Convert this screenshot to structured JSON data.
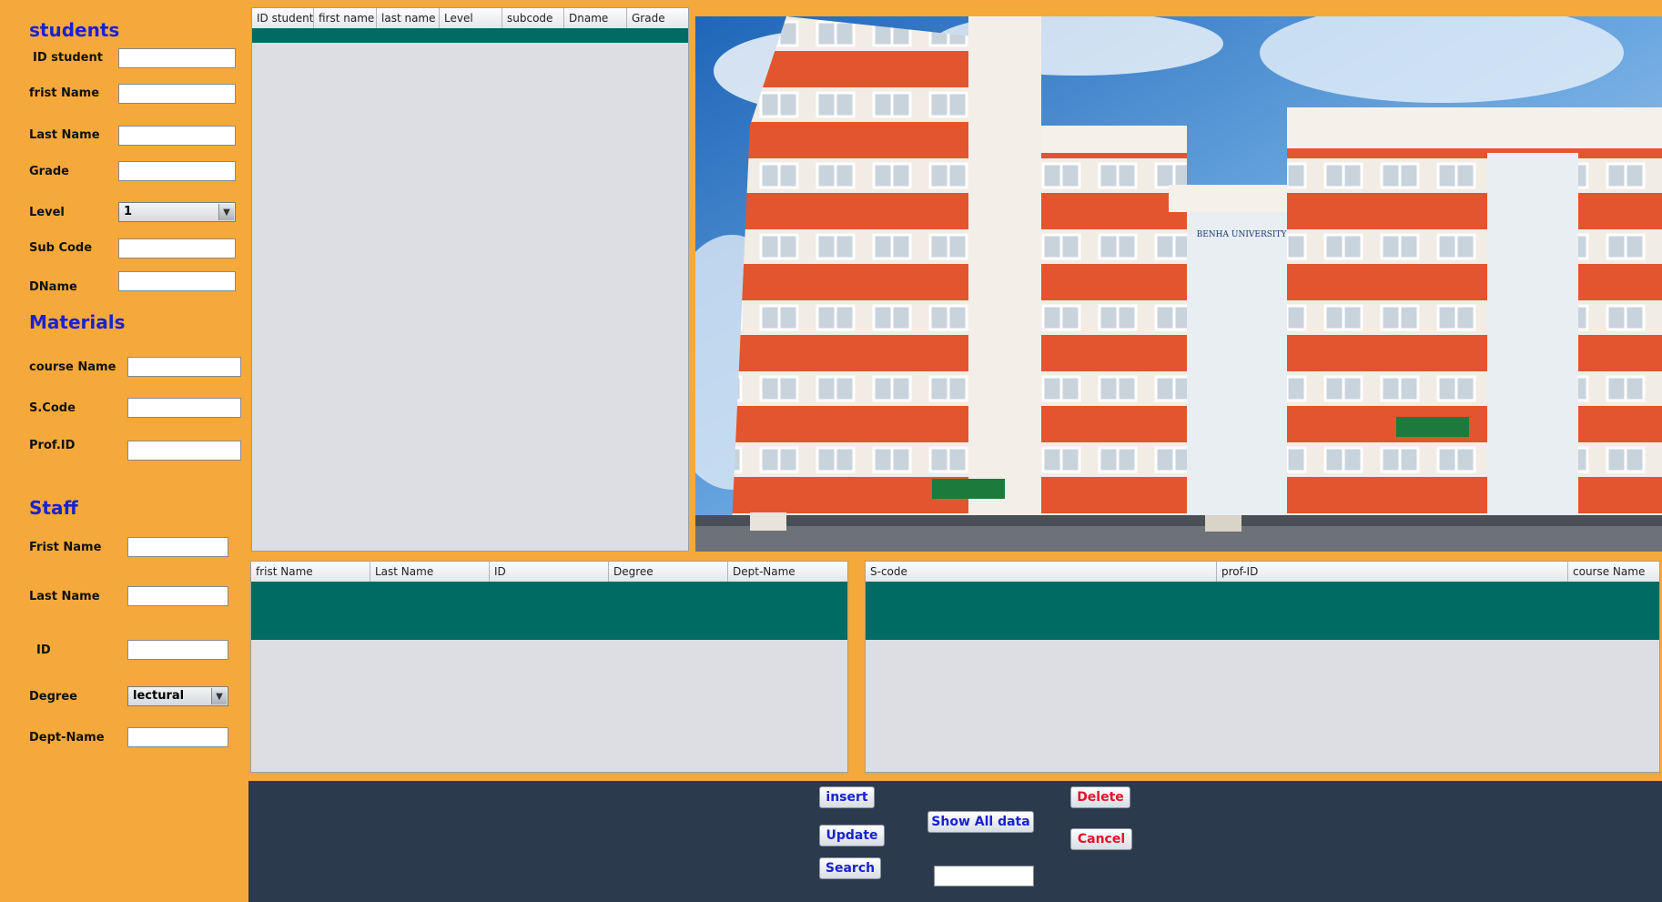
{
  "students": {
    "title": "students",
    "labels": [
      "ID student",
      "frist Name",
      "Last Name",
      "Grade",
      "Level",
      "Sub Code",
      "DName"
    ],
    "level_value": "1"
  },
  "materials": {
    "title": "Materials",
    "labels": [
      "course Name",
      "S.Code",
      "Prof.ID"
    ]
  },
  "staff": {
    "title": "Staff",
    "labels": [
      "Frist Name",
      "Last Name",
      "ID",
      "Degree",
      "Dept-Name"
    ],
    "degree_value": "lectural"
  },
  "tables": {
    "students_columns": [
      "ID student",
      "first name",
      "last name",
      "Level",
      "subcode",
      "Dname",
      "Grade"
    ],
    "staff_columns": [
      "frist Name",
      "Last Name",
      "ID",
      "Degree",
      "Dept-Name"
    ],
    "materials_columns": [
      "S-code",
      "prof-ID",
      "course Name"
    ]
  },
  "buttons": {
    "insert": "insert",
    "update": "Update",
    "search": "Search",
    "show_all": "Show All data",
    "delete": "Delete",
    "cancel": "Cancel"
  },
  "search_input_value": "",
  "photo": {
    "sign_text": "BENHA UNIVERSITY"
  },
  "colors": {
    "background": "#f5a93a",
    "section_title": "#1a22d0",
    "table_selection": "#006b63",
    "bottom_bar": "#2c3a4e",
    "danger_text": "#e0142c"
  }
}
